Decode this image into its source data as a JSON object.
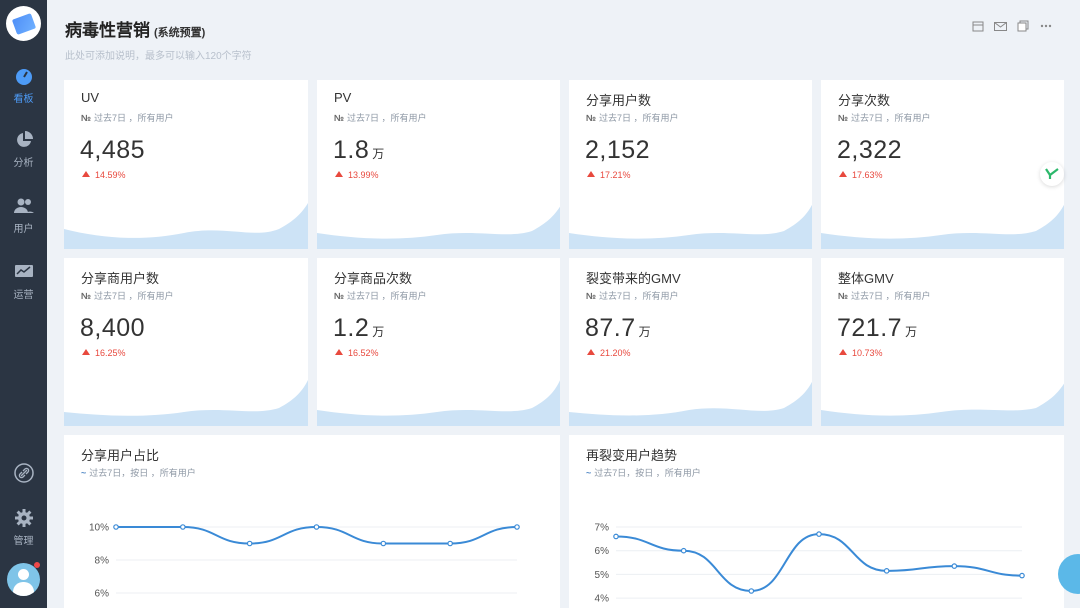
{
  "sidebar": {
    "items": [
      {
        "label": "看板",
        "icon": "dashboard-icon",
        "active": true
      },
      {
        "label": "分析",
        "icon": "pie-chart-icon",
        "active": false
      },
      {
        "label": "用户",
        "icon": "users-icon",
        "active": false
      },
      {
        "label": "运营",
        "icon": "monitor-icon",
        "active": false
      },
      {
        "label": "",
        "icon": "link-icon",
        "active": false
      },
      {
        "label": "管理",
        "icon": "gear-icon",
        "active": false
      }
    ]
  },
  "header": {
    "title": "病毒性营销",
    "subtitle": "(系统预置)",
    "description": "此处可添加说明，最多可以输入120个字符",
    "toolbar": [
      "calendar-icon",
      "mail-icon",
      "copy-icon",
      "more-icon"
    ]
  },
  "cards": [
    {
      "title": "UV",
      "meta_no": "№",
      "meta": "过去7日 ，所有用户",
      "value": "4,485",
      "unit": "",
      "change": "14.59%"
    },
    {
      "title": "PV",
      "meta_no": "№",
      "meta": "过去7日 ，所有用户",
      "value": "1.8",
      "unit": "万",
      "change": "13.99%"
    },
    {
      "title": "分享用户数",
      "meta_no": "№",
      "meta": "过去7日 ，所有用户",
      "value": "2,152",
      "unit": "",
      "change": "17.21%"
    },
    {
      "title": "分享次数",
      "meta_no": "№",
      "meta": "过去7日 ，所有用户",
      "value": "2,322",
      "unit": "",
      "change": "17.63%"
    },
    {
      "title": "分享商用户数",
      "meta_no": "№",
      "meta": "过去7日 ，所有用户",
      "value": "8,400",
      "unit": "",
      "change": "16.25%"
    },
    {
      "title": "分享商品次数",
      "meta_no": "№",
      "meta": "过去7日 ，所有用户",
      "value": "1.2",
      "unit": "万",
      "change": "16.52%"
    },
    {
      "title": "裂变带来的GMV",
      "meta_no": "№",
      "meta": "过去7日 ，所有用户",
      "value": "87.7",
      "unit": "万",
      "change": "21.20%"
    },
    {
      "title": "整体GMV",
      "meta_no": "№",
      "meta": "过去7日 ，所有用户",
      "value": "721.7",
      "unit": "万",
      "change": "10.73%"
    }
  ],
  "charts": [
    {
      "title": "分享用户占比",
      "meta": "过去7日，按日 ，所有用户"
    },
    {
      "title": "再裂变用户趋势",
      "meta": "过去7日，按日 ，所有用户"
    }
  ],
  "chart_data": [
    {
      "type": "line",
      "title": "分享用户占比",
      "y_ticks": [
        "10%",
        "8%",
        "6%"
      ],
      "y_tick_values": [
        10,
        8,
        6
      ],
      "values": [
        10,
        10,
        9,
        10,
        9,
        9,
        10
      ],
      "color": "#3a8ad6"
    },
    {
      "type": "line",
      "title": "再裂变用户趋势",
      "y_ticks": [
        "7%",
        "6%",
        "5%",
        "4%"
      ],
      "y_tick_values": [
        7,
        6,
        5,
        4
      ],
      "values": [
        6.6,
        6.0,
        4.3,
        6.7,
        5.15,
        5.35,
        4.95
      ],
      "color": "#3a8ad6"
    }
  ],
  "colors": {
    "sidebar_bg": "#2b3543",
    "accent": "#4d9bf7",
    "increase": "#e8493e",
    "spark_fill": "#cde3f6"
  }
}
